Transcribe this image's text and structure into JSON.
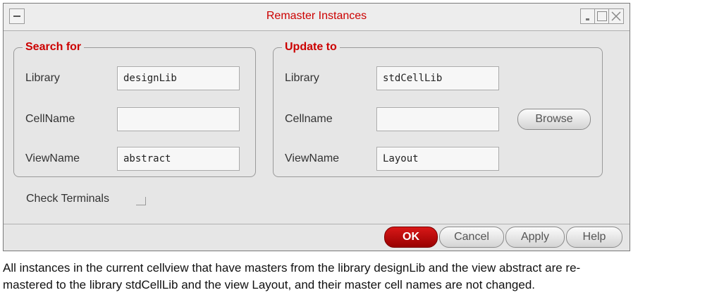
{
  "window": {
    "title": "Remaster Instances"
  },
  "search_for": {
    "legend": "Search for",
    "library_label": "Library",
    "library_value": "designLib",
    "cellname_label": "CellName",
    "cellname_value": "",
    "viewname_label": "ViewName",
    "viewname_value": "abstract"
  },
  "update_to": {
    "legend": "Update to",
    "library_label": "Library",
    "library_value": "stdCellLib",
    "cellname_label": "Cellname",
    "cellname_value": "",
    "browse_label": "Browse",
    "viewname_label": "ViewName",
    "viewname_value": "Layout"
  },
  "check_terminals": {
    "label": "Check Terminals",
    "checked": false
  },
  "buttons": {
    "ok": "OK",
    "cancel": "Cancel",
    "apply": "Apply",
    "help": "Help"
  },
  "colors": {
    "accent_red": "#cc0000",
    "dialog_bg": "#e6e6e6"
  },
  "caption": {
    "line1": "All instances in the current cellview that have masters from the library designLib and the view abstract are re-",
    "line2": "mastered to the library stdCellLib and the view Layout, and their master cell names are not changed."
  }
}
